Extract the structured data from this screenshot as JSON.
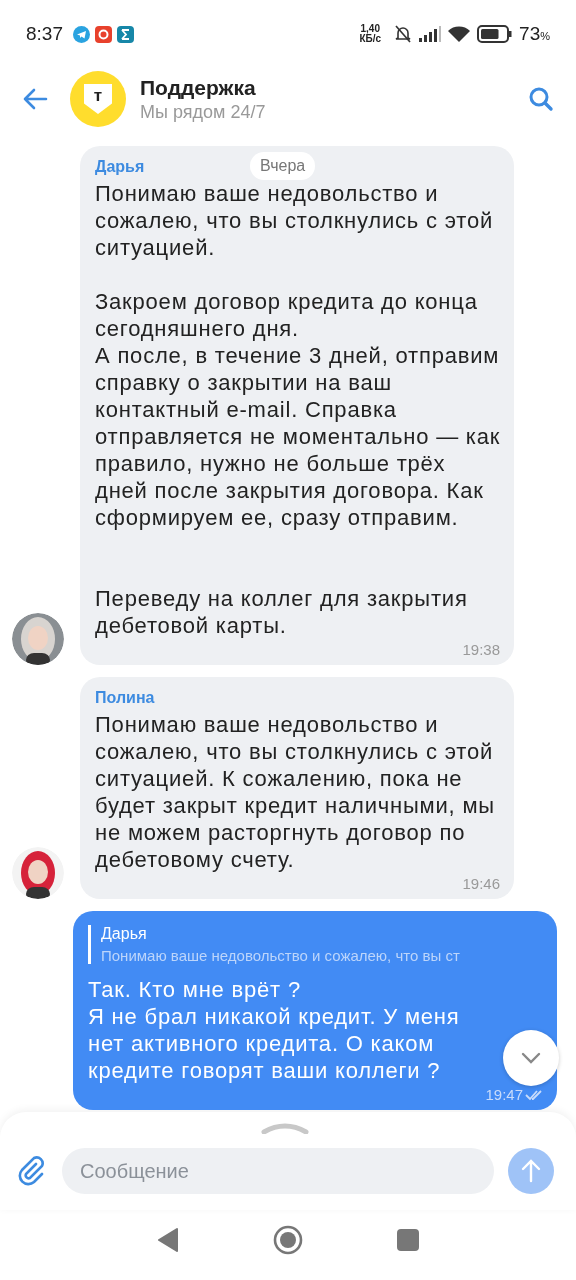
{
  "status_bar": {
    "time": "8:37",
    "net_speed": "1,40",
    "net_speed_unit": "КБ/с",
    "battery": "73",
    "battery_unit": "%"
  },
  "header": {
    "logo_letter": "т",
    "title": "Поддержка",
    "subtitle": "Мы рядом 24/7"
  },
  "date_chip": "Вчера",
  "messages": [
    {
      "kind": "incoming",
      "sender": "Дарья",
      "text": "Понимаю ваше недовольство и сожалею, что вы столкнулись с этой ситуацией.\n\nЗакроем договор кредита до конца сегодняшнего дня.\nА после, в течение 3 дней, отправим справку о закрытии на ваш контактный e-mail. Справка отправляется не моментально — как правило, нужно не больше трёх дней после закрытия договора. Как сформируем ее, сразу отправим.\n\n\nПереведу на коллег для закрытия дебетовой карты.",
      "time": "19:38"
    },
    {
      "kind": "incoming",
      "sender": "Полина",
      "text": "Понимаю ваше недовольство и сожалею, что вы столкнулись с этой ситуацией. К сожалению, пока не будет закрыт кредит наличными, мы не можем расторгнуть договор по дебетовому счету.",
      "time": "19:46"
    },
    {
      "kind": "outgoing",
      "reply_to": {
        "sender": "Дарья",
        "text": "Понимаю ваше недовольство и сожалею, что вы ст"
      },
      "text": "Так. Кто мне врёт ?\nЯ не брал никакой кредит. У меня нет активного кредита. О каком кредите говорят ваши коллеги ?",
      "time": "19:47"
    }
  ],
  "composer": {
    "placeholder": "Сообщение"
  }
}
